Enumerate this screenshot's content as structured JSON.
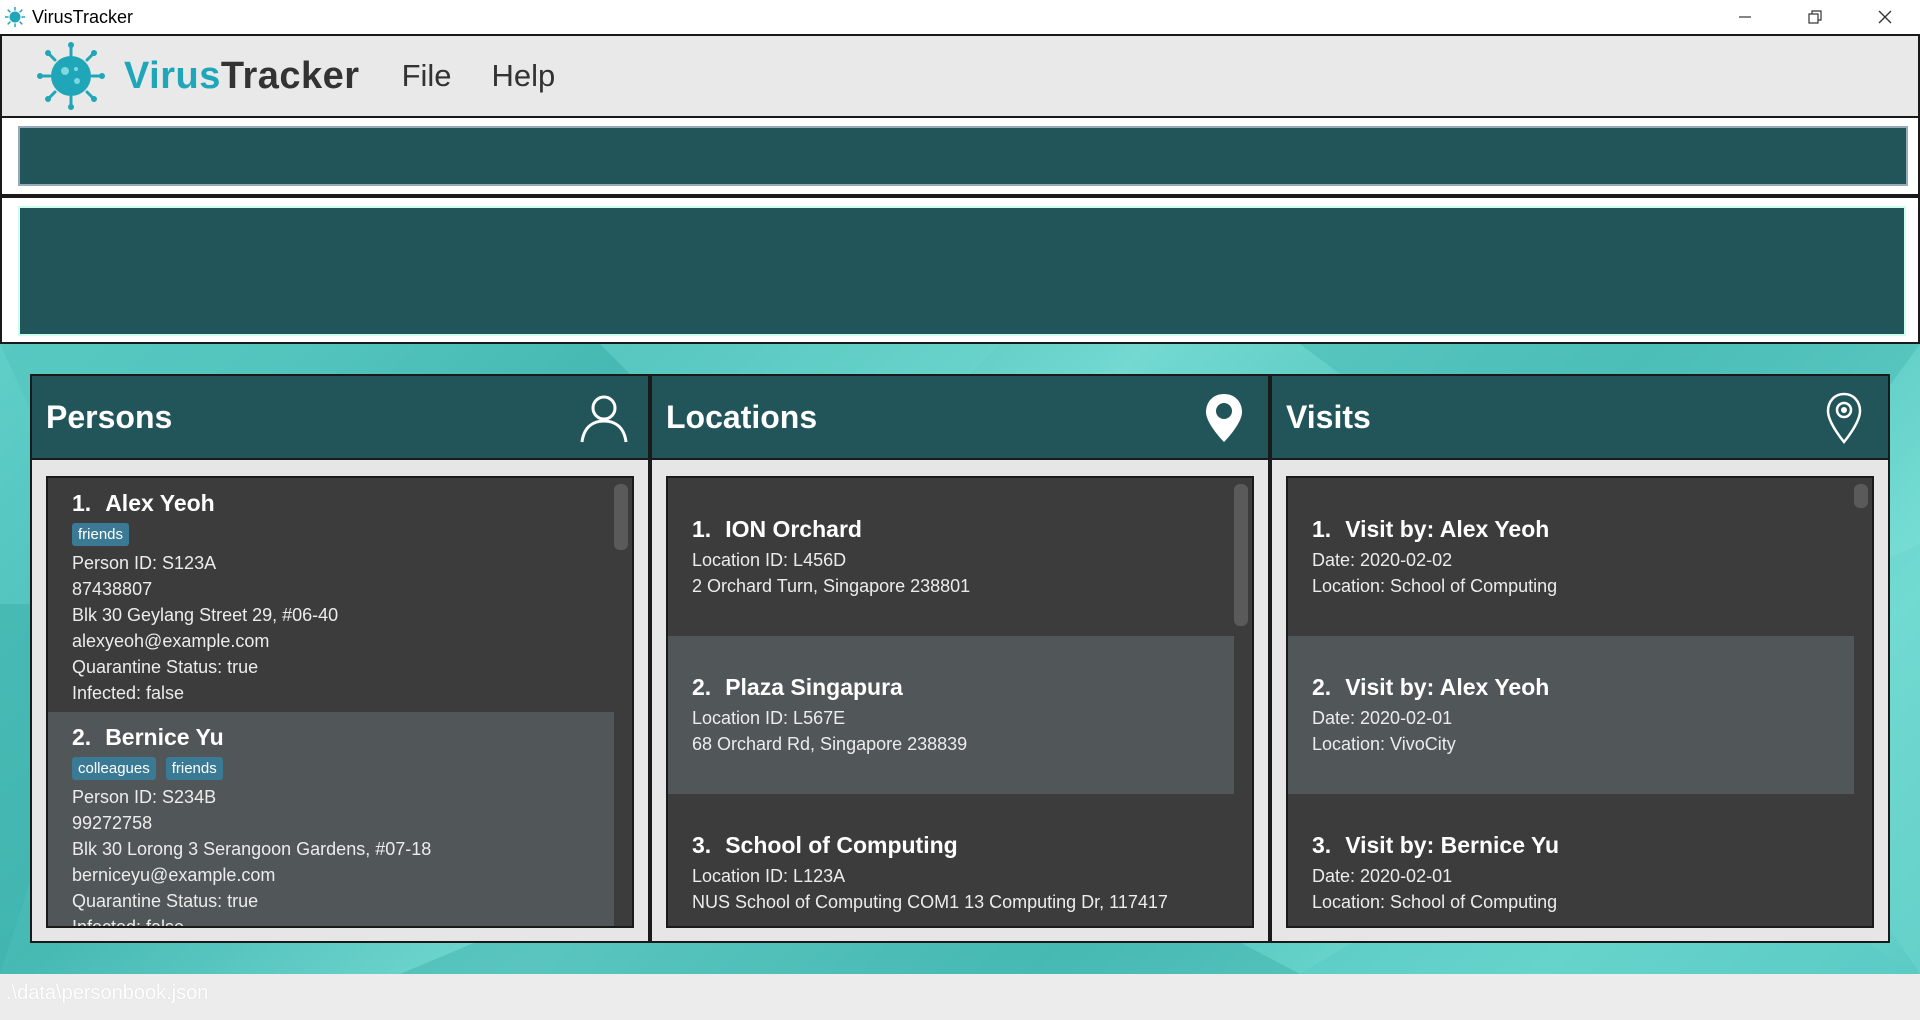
{
  "window": {
    "title": "VirusTracker"
  },
  "menubar": {
    "brand_part1": "Virus",
    "brand_part2": "Tracker",
    "menu": [
      "File",
      "Help"
    ]
  },
  "colors": {
    "accent": "#1fa6b8",
    "panel_header": "#22555a",
    "tag": "#3b7a95"
  },
  "command_box": {
    "value": ""
  },
  "result_display": {
    "value": ""
  },
  "panels": {
    "persons": {
      "title": "Persons",
      "icon": "person-icon",
      "items": [
        {
          "index": "1.",
          "name": "Alex Yeoh",
          "tags": [
            "friends"
          ],
          "person_id": "Person ID: S123A",
          "phone": "87438807",
          "address": "Blk 30 Geylang Street 29, #06-40",
          "email": "alexyeoh@example.com",
          "quarantine": "Quarantine Status: true",
          "infected": "Infected: false"
        },
        {
          "index": "2.",
          "name": "Bernice Yu",
          "tags": [
            "colleagues",
            "friends"
          ],
          "person_id": "Person ID: S234B",
          "phone": "99272758",
          "address": "Blk 30 Lorong 3 Serangoon Gardens, #07-18",
          "email": "berniceyu@example.com",
          "quarantine": "Quarantine Status: true",
          "infected": "Infected: false"
        }
      ]
    },
    "locations": {
      "title": "Locations",
      "icon": "location-pin-icon",
      "items": [
        {
          "index": "1.",
          "name": "ION Orchard",
          "id": "Location ID: L456D",
          "address": "2 Orchard Turn, Singapore 238801"
        },
        {
          "index": "2.",
          "name": "Plaza Singapura",
          "id": "Location ID: L567E",
          "address": "68 Orchard Rd, Singapore 238839"
        },
        {
          "index": "3.",
          "name": "School of Computing",
          "id": "Location ID: L123A",
          "address": "NUS School of Computing COM1 13 Computing Dr, 117417"
        }
      ]
    },
    "visits": {
      "title": "Visits",
      "icon": "visit-pin-icon",
      "items": [
        {
          "index": "1.",
          "name": "Visit by: Alex Yeoh",
          "date": "Date: 2020-02-02",
          "location": "Location: School of Computing"
        },
        {
          "index": "2.",
          "name": "Visit by: Alex Yeoh",
          "date": "Date: 2020-02-01",
          "location": "Location: VivoCity"
        },
        {
          "index": "3.",
          "name": "Visit by: Bernice Yu",
          "date": "Date: 2020-02-01",
          "location": "Location: School of Computing"
        }
      ]
    }
  },
  "statusbar": {
    "path": ".\\data\\personbook.json"
  }
}
